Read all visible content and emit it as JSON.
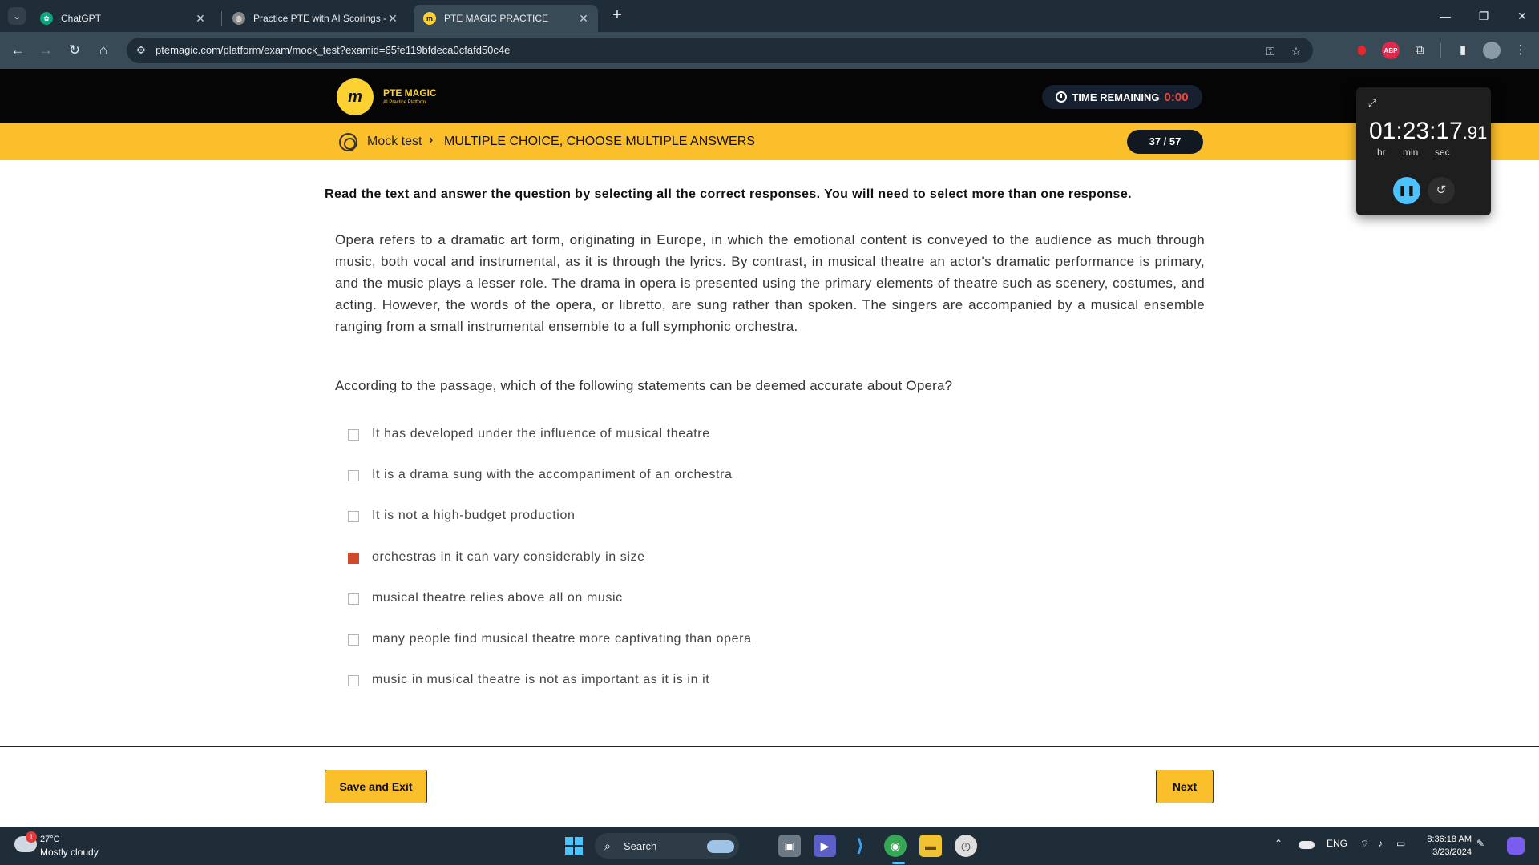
{
  "browser": {
    "tabs": [
      {
        "title": "ChatGPT",
        "favicon": "chatgpt-icon",
        "active": false
      },
      {
        "title": "Practice PTE with AI Scorings - I",
        "favicon": "globe-icon",
        "active": false
      },
      {
        "title": "PTE MAGIC PRACTICE",
        "favicon": "ptemagic-icon",
        "active": true
      }
    ],
    "url": "ptemagic.com/platform/exam/mock_test?examid=65fe119bfdeca0cfafd50c4e",
    "extensions": [
      {
        "name": "record-icon",
        "color": "#e8262b",
        "label": ""
      },
      {
        "name": "adblock-icon",
        "color": "#e0294d",
        "label": "ABP"
      }
    ]
  },
  "app": {
    "brand": "PTE MAGIC",
    "brand_sub": "AI Practice Platform",
    "logo_mark": "m",
    "time_remaining_label": "TIME REMAINING",
    "time_remaining_value": "0:00",
    "breadcrumb": {
      "home": "Mock test",
      "current": "MULTIPLE CHOICE, CHOOSE MULTIPLE ANSWERS"
    },
    "progress": "37 / 57",
    "colors": {
      "accent": "#fbbf2c",
      "selected": "#d24a2e",
      "header": "#050505"
    }
  },
  "stopwatch": {
    "time_main": "01:23:17",
    "time_frac": ".91",
    "labels": [
      "hr",
      "min",
      "sec"
    ]
  },
  "exam": {
    "instruction": "Read the text and answer the question by selecting all the correct responses. You will need to select more than one response.",
    "passage": "Opera refers to a dramatic art form, originating in Europe, in which the emotional content is conveyed to the audience as much through music, both vocal and instrumental, as it is through the lyrics. By contrast, in musical theatre an actor's dramatic performance is primary, and the music plays a lesser role. The drama in opera is presented using the primary elements of theatre such as scenery, costumes, and acting. However, the words of the opera, or libretto, are sung rather than spoken. The singers are accompanied by a musical ensemble ranging from a small instrumental ensemble to a full symphonic orchestra.",
    "question": "According to the passage, which of the following statements can be deemed accurate about Opera?",
    "options": [
      {
        "label": "It has developed under the influence of musical theatre",
        "checked": false
      },
      {
        "label": "It is a drama sung with the accompaniment of an orchestra",
        "checked": false
      },
      {
        "label": "It is not a high-budget production",
        "checked": false
      },
      {
        "label": "orchestras in it can vary considerably in size",
        "checked": true
      },
      {
        "label": "musical theatre relies above all on music",
        "checked": false
      },
      {
        "label": "many people find musical theatre more captivating than opera",
        "checked": false
      },
      {
        "label": "music in musical theatre is not as important as it is in it",
        "checked": false
      }
    ],
    "save_exit_label": "Save and Exit",
    "next_label": "Next"
  },
  "taskbar": {
    "weather_badge": "1",
    "weather_temp": "27°C",
    "weather_desc": "Mostly cloudy",
    "search_label": "Search",
    "language": "ENG",
    "time": "8:36:18 AM",
    "date": "3/23/2024"
  }
}
